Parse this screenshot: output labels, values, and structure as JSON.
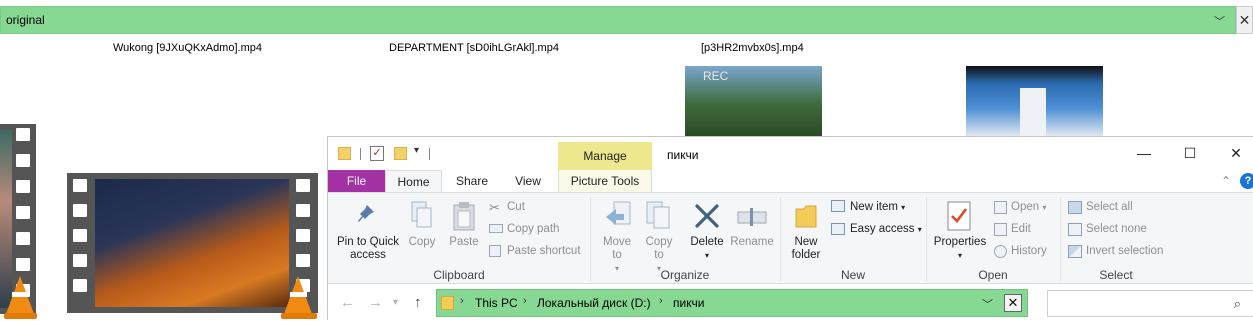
{
  "background": {
    "address_text": "original",
    "files": [
      {
        "name": "Wukong [9JXuQKxAdmo].mp4"
      },
      {
        "name": "DEPARTMENT [sD0ihLGrAkl].mp4"
      },
      {
        "name": "[p3HR2mvbx0s].mp4"
      }
    ],
    "thumb_overlay_text": "REC"
  },
  "window": {
    "title": "пикчи",
    "contextual_tab": "Manage",
    "controls": {
      "minimize": "—",
      "maximize": "☐",
      "close": "✕"
    },
    "tabs": [
      "File",
      "Home",
      "Share",
      "View",
      "Picture Tools"
    ],
    "help_label": "?",
    "ribbon": {
      "clipboard": {
        "pin_label": "Pin to Quick access",
        "copy_label": "Copy",
        "paste_label": "Paste",
        "cut_label": "Cut",
        "copy_path_label": "Copy path",
        "paste_shortcut_label": "Paste shortcut",
        "group_label": "Clipboard"
      },
      "organize": {
        "move_to_label": "Move to",
        "copy_to_label": "Copy to",
        "delete_label": "Delete",
        "rename_label": "Rename",
        "group_label": "Organize"
      },
      "new": {
        "new_folder_label": "New folder",
        "new_item_label": "New item",
        "easy_access_label": "Easy access",
        "group_label": "New"
      },
      "open": {
        "properties_label": "Properties",
        "open_label": "Open",
        "edit_label": "Edit",
        "history_label": "History",
        "group_label": "Open"
      },
      "select": {
        "select_all_label": "Select all",
        "select_none_label": "Select none",
        "invert_label": "Invert selection",
        "group_label": "Select"
      }
    },
    "address": {
      "crumbs": [
        "This PC",
        "Локальный диск (D:)",
        "пикчи"
      ],
      "search_placeholder": ""
    }
  },
  "colors": {
    "address_bar": "#86d893",
    "file_tab": "#a432a4",
    "manage_tab": "#ede88d",
    "help": "#1a73d9"
  }
}
